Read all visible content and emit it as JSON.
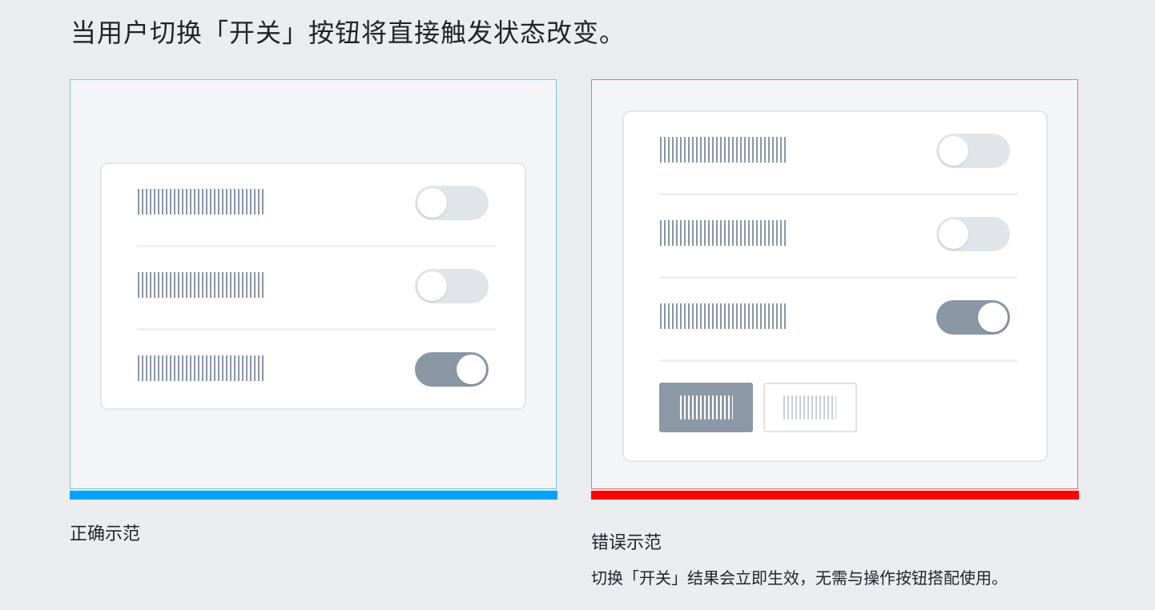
{
  "heading": "当用户切换「开关」按钮将直接触发状态改变。",
  "correct": {
    "caption": "正确示范",
    "rows": [
      {
        "toggle": "off"
      },
      {
        "toggle": "off"
      },
      {
        "toggle": "on"
      }
    ]
  },
  "wrong": {
    "caption": "错误示范",
    "description": "切换「开关」结果会立即生效，无需与操作按钮搭配使用。",
    "rows": [
      {
        "toggle": "off"
      },
      {
        "toggle": "off"
      },
      {
        "toggle": "on"
      }
    ],
    "buttons": [
      "primary",
      "secondary"
    ]
  },
  "colors": {
    "correct_accent": "#00a2ff",
    "wrong_accent": "#ff0000",
    "toggle_on": "#8a97a5",
    "toggle_off": "#e1e4e8"
  }
}
